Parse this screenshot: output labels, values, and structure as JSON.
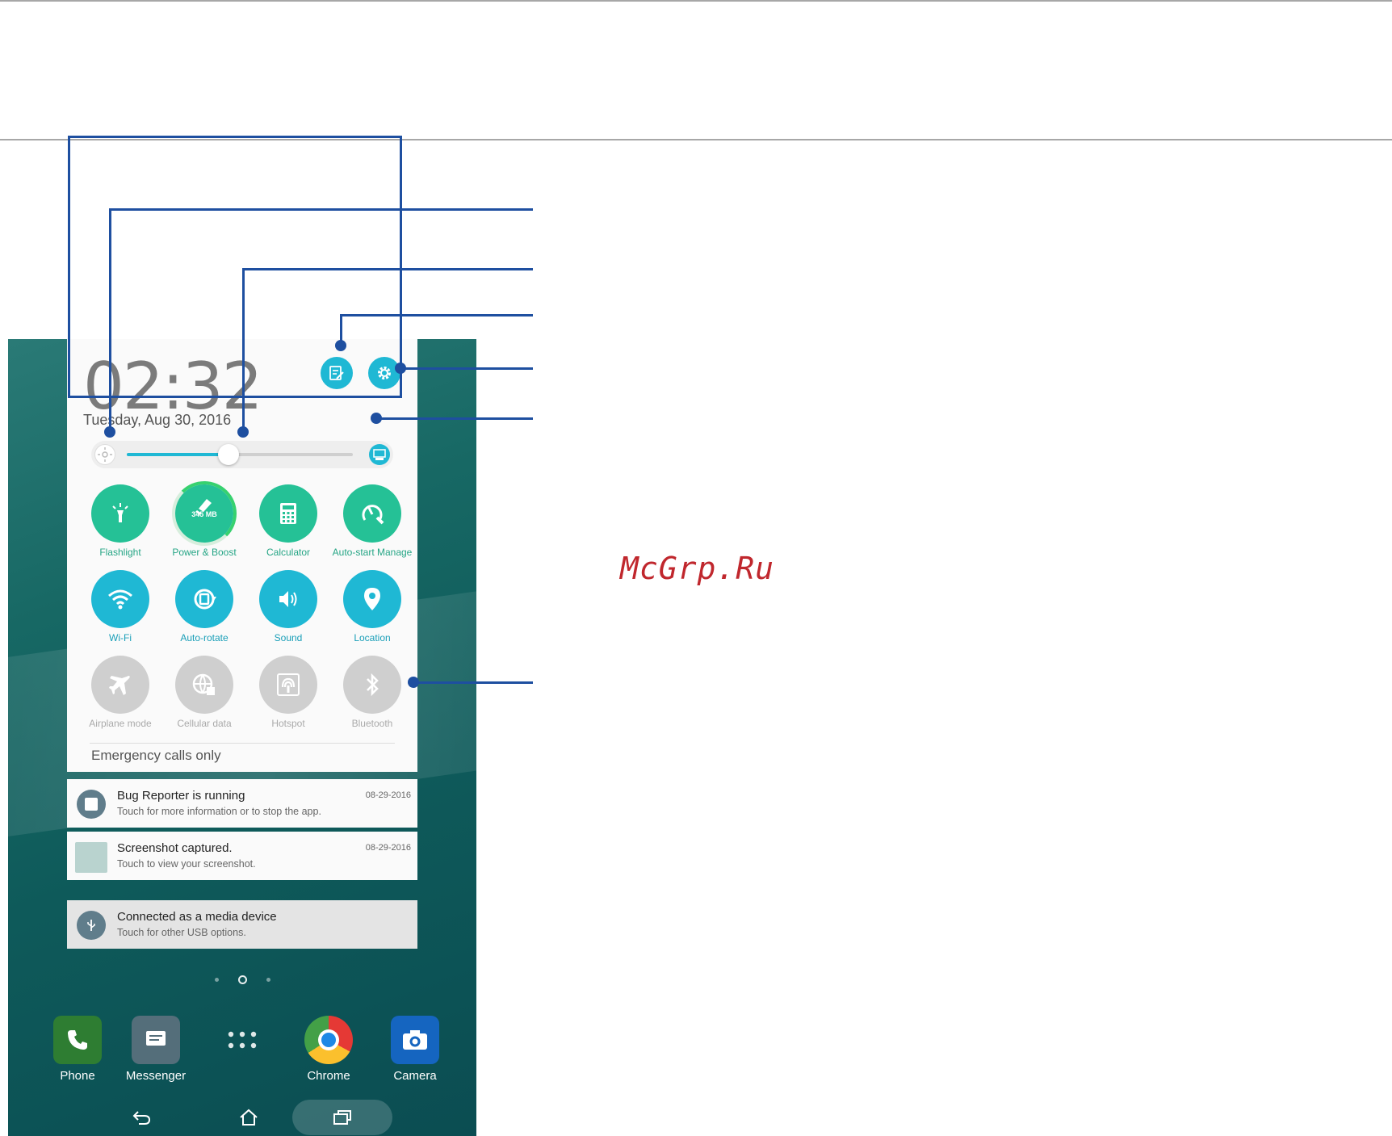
{
  "panel": {
    "time": "02:32",
    "date": "Tuesday, Aug 30, 2016",
    "brightness_level": 0.45,
    "emergency": "Emergency calls only"
  },
  "tiles": [
    {
      "label": "Flashlight",
      "icon": "flashlight-icon",
      "state": "on"
    },
    {
      "label": "Power & Boost",
      "icon": "boost-icon",
      "state": "on",
      "badge": "345 MB"
    },
    {
      "label": "Calculator",
      "icon": "calculator-icon",
      "state": "on"
    },
    {
      "label": "Auto-start Manage",
      "icon": "auto-start-icon",
      "state": "on"
    },
    {
      "label": "Wi-Fi",
      "icon": "wifi-icon",
      "state": "on"
    },
    {
      "label": "Auto-rotate",
      "icon": "auto-rotate-icon",
      "state": "on"
    },
    {
      "label": "Sound",
      "icon": "sound-icon",
      "state": "on"
    },
    {
      "label": "Location",
      "icon": "location-icon",
      "state": "on"
    },
    {
      "label": "Airplane mode",
      "icon": "airplane-icon",
      "state": "off"
    },
    {
      "label": "Cellular data",
      "icon": "cellular-data-icon",
      "state": "off"
    },
    {
      "label": "Hotspot",
      "icon": "hotspot-icon",
      "state": "off"
    },
    {
      "label": "Bluetooth",
      "icon": "bluetooth-icon",
      "state": "off"
    }
  ],
  "notifications": [
    {
      "title": "Bug Reporter is running",
      "sub": "Touch for more information or to stop the app.",
      "time": "08-29-2016"
    },
    {
      "title": "Screenshot captured.",
      "sub": "Touch to view your screenshot.",
      "time": "08-29-2016"
    },
    {
      "title": "Connected as a media device",
      "sub": "Touch for other USB options.",
      "time": ""
    }
  ],
  "dock": [
    {
      "name": "Phone",
      "color": "#2e7d32"
    },
    {
      "name": "Messenger",
      "color": "#546e7a"
    },
    {
      "name": "",
      "color": ""
    },
    {
      "name": "Chrome",
      "color": "#e53935"
    },
    {
      "name": "Camera",
      "color": "#1565c0"
    }
  ],
  "watermark": "McGrp.Ru",
  "colors": {
    "cyan": "#1fb8d4",
    "green": "#25c196",
    "callout": "#1e4fa0"
  }
}
